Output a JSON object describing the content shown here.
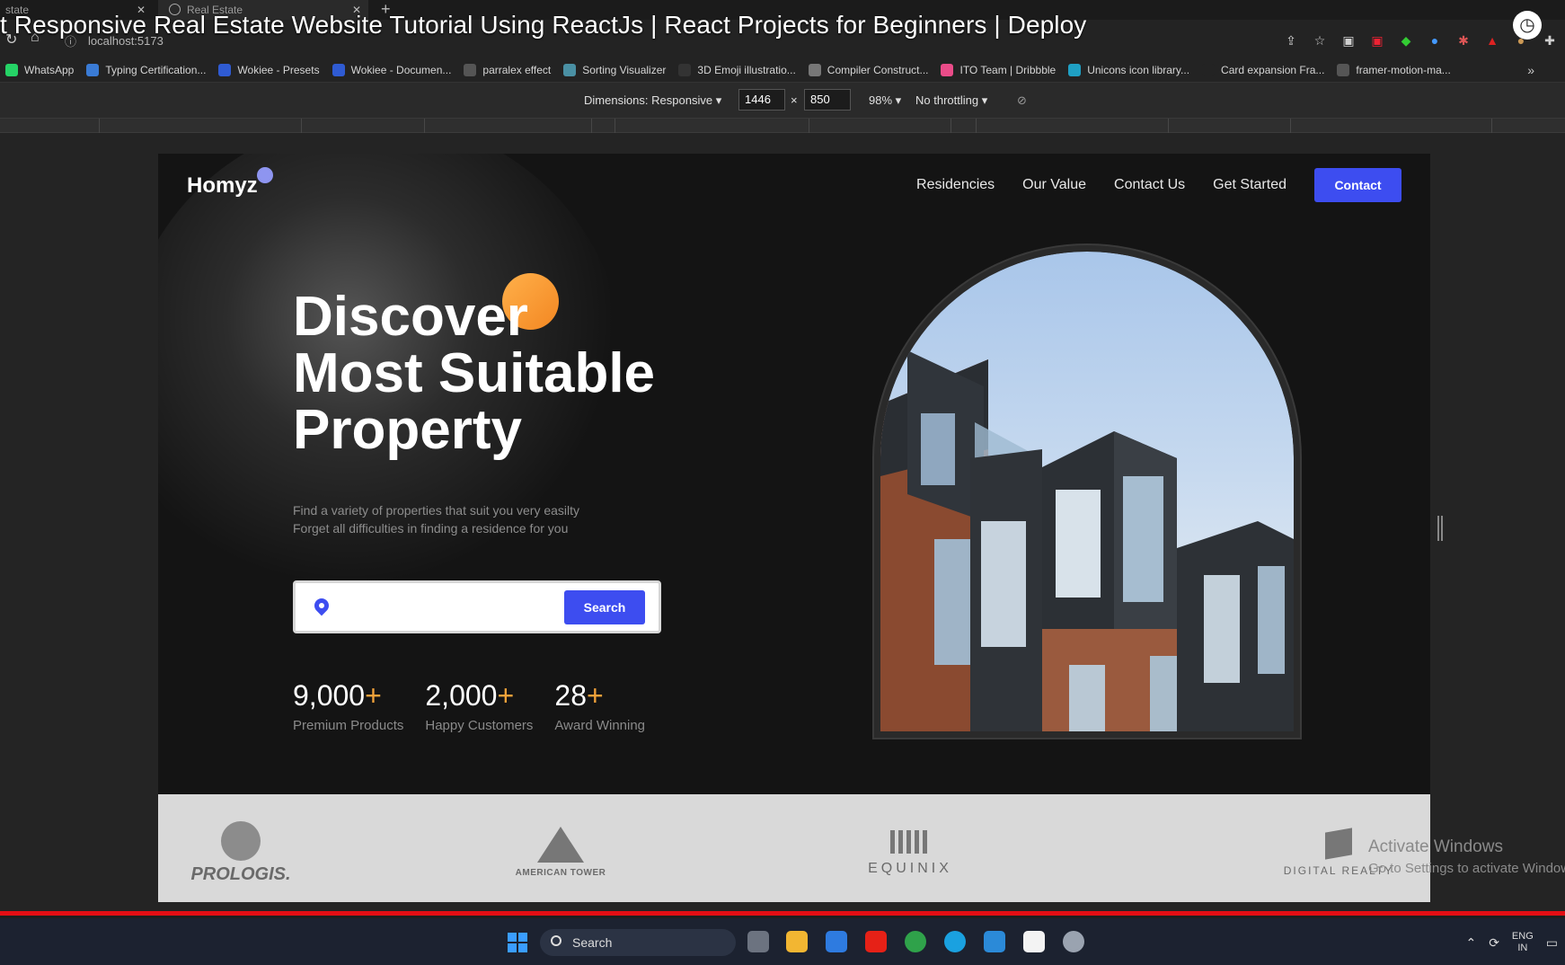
{
  "browser": {
    "tabs": [
      {
        "label": "state"
      },
      {
        "label": "Real Estate"
      }
    ],
    "url": "localhost:5173",
    "video_title": "t Responsive Real Estate Website Tutorial Using ReactJs | React Projects for Beginners | Deploy",
    "bookmarks": [
      {
        "label": "WhatsApp",
        "color": "#25d366"
      },
      {
        "label": "Typing Certification...",
        "color": "#3a7bd5"
      },
      {
        "label": "Wokiee - Presets",
        "color": "#2f5bd3"
      },
      {
        "label": "Wokiee - Documen...",
        "color": "#2f5bd3"
      },
      {
        "label": "parralex effect",
        "color": "#555555"
      },
      {
        "label": "Sorting Visualizer",
        "color": "#4a90a4"
      },
      {
        "label": "3D Emoji illustratio...",
        "color": "#333333"
      },
      {
        "label": "Compiler Construct...",
        "color": "#777777"
      },
      {
        "label": "ITO Team | Dribbble",
        "color": "#ea4c89"
      },
      {
        "label": "Unicons icon library...",
        "color": "#1fa0c4"
      },
      {
        "label": "Card expansion Fra...",
        "color": "#232323"
      },
      {
        "label": "framer-motion-ma...",
        "color": "#555555"
      }
    ]
  },
  "devtools": {
    "dimensions_label": "Dimensions: Responsive",
    "width": "1446",
    "times": "×",
    "height": "850",
    "zoom": "98%",
    "throttling": "No throttling"
  },
  "site": {
    "logo": "Homyz",
    "nav": [
      "Residencies",
      "Our Value",
      "Contact Us",
      "Get Started"
    ],
    "nav_button": "Contact",
    "hero_title": [
      "Discover",
      "Most Suitable",
      "Property"
    ],
    "hero_sub": [
      "Find a variety of properties that suit you very easilty",
      "Forget all difficulties in finding a residence for you"
    ],
    "search_button": "Search",
    "stats": [
      {
        "value": "9,000",
        "plus": "+",
        "label": "Premium Products"
      },
      {
        "value": "2,000",
        "plus": "+",
        "label": "Happy Customers"
      },
      {
        "value": "28",
        "plus": "+",
        "label": "Award Winning"
      }
    ],
    "companies": [
      "PROLOGIS.",
      "AMERICAN TOWER",
      "EQUINIX",
      "DIGITAL REALTY"
    ]
  },
  "watermark": {
    "title": "Activate Windows",
    "sub": "Go to Settings to activate Windows."
  },
  "taskbar": {
    "search": "Search",
    "lang": "ENG",
    "region": "IN"
  },
  "colors": {
    "accent": "#3d4df0",
    "orange": "#f38722"
  }
}
